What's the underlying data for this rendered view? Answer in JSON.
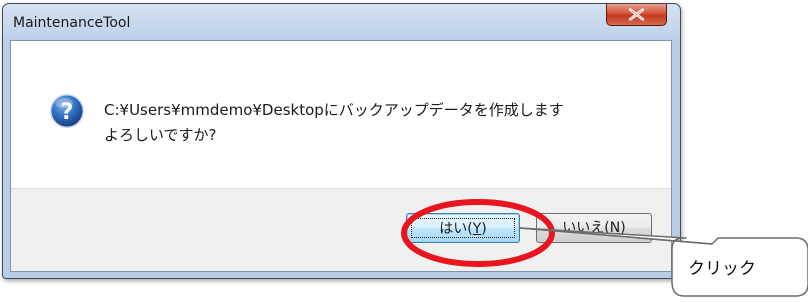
{
  "dialog": {
    "title": "MaintenanceTool",
    "close_label": "X",
    "message_line1": "C:¥Users¥mmdemo¥Desktopにバックアップデータを作成します",
    "message_line2": "よろしいですか?",
    "icon": "question-icon"
  },
  "buttons": {
    "yes": {
      "text": "はい(",
      "mnemonic": "Y",
      "suffix": ")"
    },
    "no": {
      "text": "いいえ(",
      "mnemonic": "N",
      "suffix": ")"
    }
  },
  "annotation": {
    "callout_text": "クリック",
    "highlight_color": "#e8141e"
  },
  "colors": {
    "titlebar": "#c3d5ec",
    "close_button": "#c23a20",
    "icon_blue": "#2f5ea8",
    "default_button_border": "#3c7fb1"
  }
}
